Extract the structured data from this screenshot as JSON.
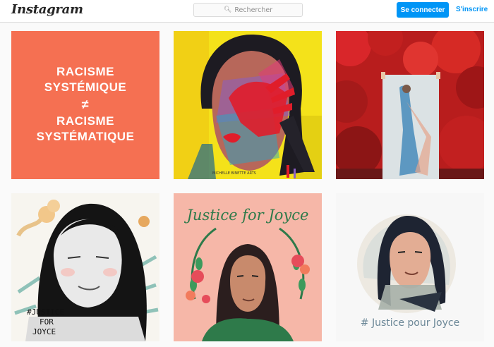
{
  "header": {
    "logo": "Instagram",
    "search_placeholder": "Rechercher",
    "login_label": "Se connecter",
    "signup_label": "S'inscrire"
  },
  "posts": [
    {
      "lines": [
        "RACISME",
        "SYSTÉMIQUE",
        "≠",
        "RACISME",
        "SYSTÉMATIQUE"
      ],
      "background": "#f57052"
    },
    {
      "signature": "MICHELLE BINETTE ARTS"
    },
    {},
    {
      "caption": [
        "#JUSTICE",
        "FOR",
        "JOYCE"
      ]
    },
    {
      "caption": "Justice for Joyce"
    },
    {
      "caption": "# Justice pour Joyce"
    }
  ]
}
